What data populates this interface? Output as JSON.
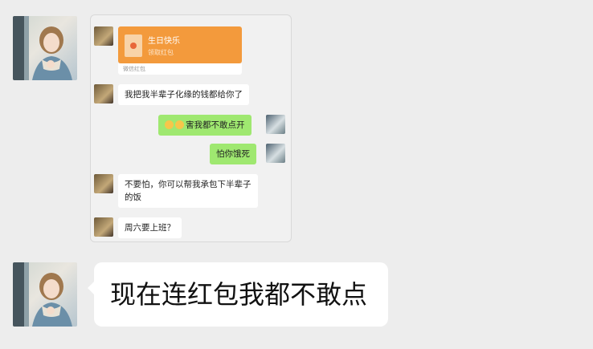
{
  "card": {
    "red_packet": {
      "title": "生日快乐",
      "subtitle": "领取红包",
      "footer": "微信红包"
    },
    "messages": [
      {
        "side": "left",
        "text": "我把我半辈子化缘的钱都给你了"
      },
      {
        "side": "right",
        "text": "害我都不敢点开",
        "emoji_count": 2
      },
      {
        "side": "right",
        "text": "怕你饿死"
      },
      {
        "side": "left",
        "line1": "不要怕，你可以帮我承包下半辈子",
        "line2": "的饭"
      },
      {
        "side": "left",
        "text": "周六要上班？"
      }
    ]
  },
  "main_message": {
    "text": "现在连红包我都不敢点"
  }
}
